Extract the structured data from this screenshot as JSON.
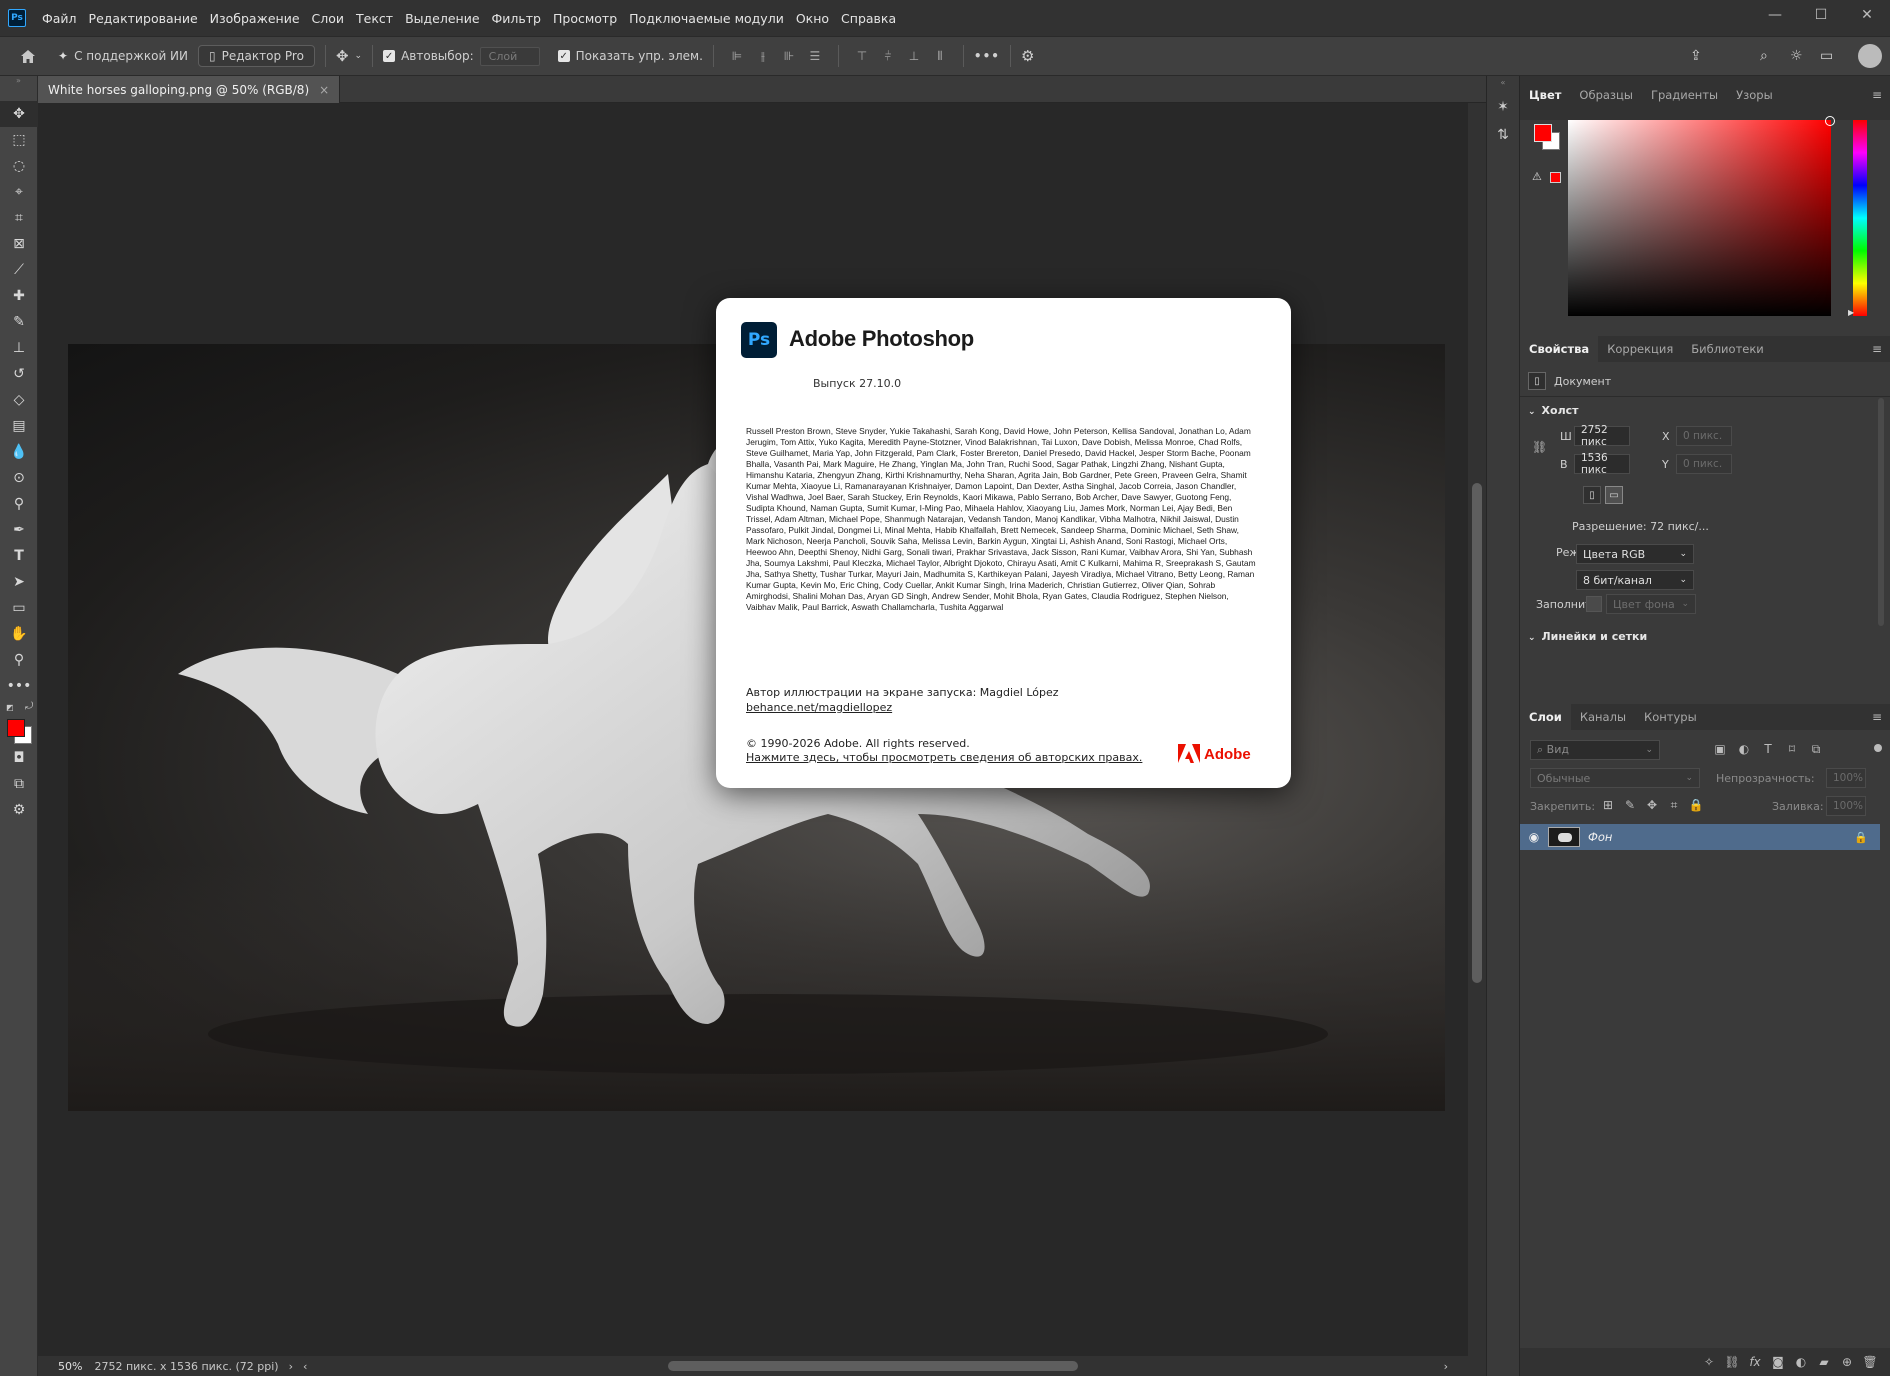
{
  "menubar": {
    "logo": "Ps",
    "items": [
      "Файл",
      "Редактирование",
      "Изображение",
      "Слои",
      "Текст",
      "Выделение",
      "Фильтр",
      "Просмотр",
      "Подключаемые модули",
      "Окно",
      "Справка"
    ],
    "win": {
      "minimize": "—",
      "maximize": "☐",
      "close": "✕"
    }
  },
  "options": {
    "home_icon": "home-icon",
    "ai_label": "С поддержкой ИИ",
    "pro_label": "Редактор Pro",
    "autoselect_label": "Автовыбор:",
    "autoselect_value": "Слой",
    "show_transform_label": "Показать упр. элем.",
    "more": "•••"
  },
  "document": {
    "tab_title": "White horses galloping.png @ 50% (RGB/8)",
    "tab_close": "×",
    "zoom": "50%",
    "status": "2752 пикс. x 1536 пикс. (72 ppi)",
    "status_arrow": "›",
    "scroll_left": "‹",
    "scroll_right": "›"
  },
  "splash": {
    "logo": "Ps",
    "title": "Adobe Photoshop",
    "version": "Выпуск 27.10.0",
    "credits": "Russell Preston Brown, Steve Snyder, Yukie Takahashi, Sarah Kong, David Howe, John Peterson, Kellisa Sandoval, Jonathan Lo, Adam Jerugim, Tom Attix, Yuko Kagita, Meredith Payne-Stotzner, Vinod Balakrishnan, Tai Luxon, Dave Dobish, Melissa Monroe, Chad Rolfs, Steve Guilhamet, Maria Yap, John Fitzgerald, Pam Clark, Foster Brereton, Daniel Presedo, David Hackel, Jesper Storm Bache, Poonam Bhalla, Vasanth Pai, Mark Maguire, He Zhang, Yinglan Ma, John Tran, Ruchi Sood, Sagar Pathak, Lingzhi Zhang, Nishant Gupta, Himanshu Kataria, Zhengyun Zhang, Kirthi Krishnamurthy, Neha Sharan, Agrita Jain, Bob Gardner, Pete Green, Praveen Gelra, Shamit Kumar Mehta, Xiaoyue Li, Ramanarayanan Krishnaiyer, Damon Lapoint, Dan Dexter, Astha Singhal, Jacob Correia, Jason Chandler, Vishal Wadhwa, Joel Baer, Sarah Stuckey, Erin Reynolds, Kaori Mikawa, Pablo Serrano, Bob Archer, Dave Sawyer, Guotong Feng, Sudipta Khound, Naman Gupta, Sumit Kumar, I-Ming Pao, Mihaela Hahlov, Xiaoyang Liu, James Mork, Norman Lei, Ajay Bedi, Ben Trissel, Adam Altman, Michael Pope, Shanmugh Natarajan, Vedansh Tandon, Manoj Kandlikar, Vibha Malhotra, Nikhil Jaiswal, Dustin Passofaro, Pulkit Jindal, Dongmei Li, Minal Mehta, Habib Khalfallah, Brett Nemecek, Sandeep Sharma, Dominic Michael, Seth Shaw, Mark Nichoson, Neerja Pancholi, Souvik Saha, Melissa Levin, Barkin Aygun, Xingtai Li, Ashish Anand, Soni Rastogi, Michael Orts, Heewoo Ahn, Deepthi Shenoy, Nidhi Garg, Sonali tiwari, Prakhar Srivastava, Jack Sisson, Rani Kumar, Vaibhav Arora, Shi Yan, Subhash Jha, Soumya Lakshmi, Paul Kleczka, Michael Taylor, Albright Djokoto, Chirayu Asati, Amit C Kulkarni, Mahima R, Sreeprakash S, Gautam Jha, Sathya Shetty, Tushar Turkar, Mayuri Jain, Madhumita S, Karthikeyan Palani, Jayesh Viradiya, Michael Vitrano, Betty Leong, Raman Kumar Gupta, Kevin Mo, Eric Ching, Cody Cuellar, Ankit Kumar Singh, Irina Maderich, Christian Gutierrez, Oliver Qian, Sohrab Amirghodsi, Shalini Mohan Das, Aryan GD Singh, Andrew Sender, Mohit Bhola, Ryan Gates, Claudia Rodriguez, Stephen Nielson, Vaibhav Malik, Paul Barrick, Aswath Challamcharla, Tushita Aggarwal",
    "author": "Автор иллюстрации на экране запуска: Magdiel López",
    "author_link": "behance.net/magdiellopez",
    "copyright": "© 1990-2026 Adobe. All rights reserved.",
    "rights_link": "Нажмите здесь, чтобы просмотреть сведения об авторских правах.",
    "adobe_label": "Adobe"
  },
  "color_panel": {
    "tabs": [
      "Цвет",
      "Образцы",
      "Градиенты",
      "Узоры"
    ],
    "foreground": "#ff0000",
    "background": "#ffffff",
    "hue_color": "#ff0000"
  },
  "properties": {
    "tabs": [
      "Свойства",
      "Коррекция",
      "Библиотеки"
    ],
    "doc_label": "Документ",
    "canvas_section": "Холст",
    "w_label": "Ш",
    "w_value": "2752 пикс",
    "h_label": "В",
    "h_value": "1536 пикс",
    "x_label": "X",
    "x_value": "0 пикс.",
    "y_label": "Y",
    "y_value": "0 пикс.",
    "resolution": "Разрешение: 72 пикс/...",
    "mode_label": "Режим",
    "mode_value": "Цвета RGB",
    "depth_value": "8 бит/канал",
    "fill_label": "Заполнить",
    "fill_value": "Цвет фона",
    "grids_section": "Линейки и сетки"
  },
  "layers": {
    "tabs": [
      "Слои",
      "Каналы",
      "Контуры"
    ],
    "search_placeholder": "Вид",
    "blend_mode": "Обычные",
    "opacity_label": "Непрозрачность:",
    "opacity_value": "100%",
    "lock_label": "Закрепить:",
    "fill_label": "Заливка:",
    "fill_value": "100%",
    "layer_name": "Фон"
  }
}
